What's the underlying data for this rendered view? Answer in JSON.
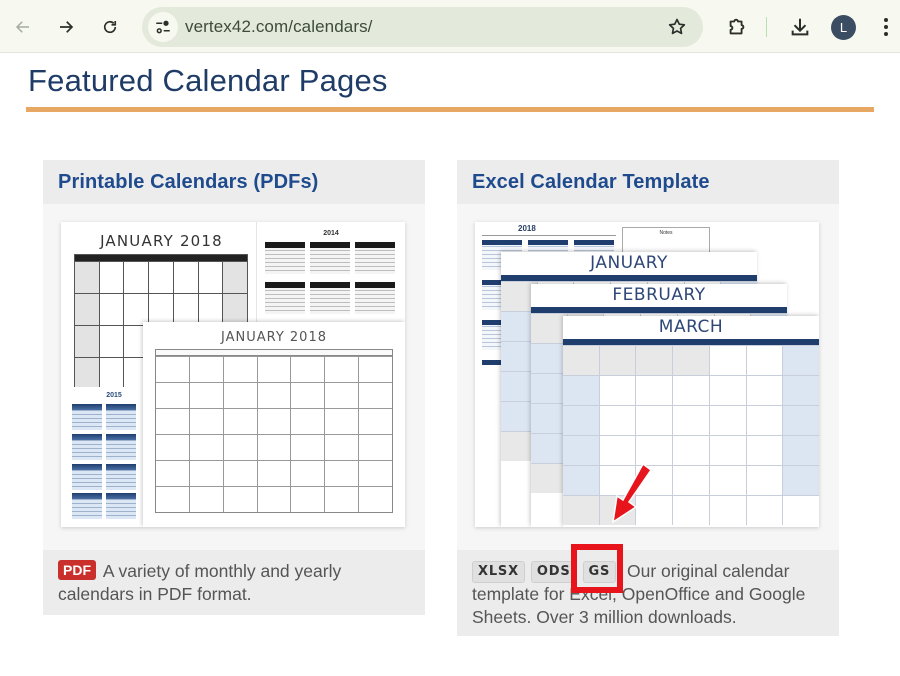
{
  "browser": {
    "url": "vertex42.com/calendars/",
    "profile_initial": "L",
    "icons": {
      "back": "arrow-left-icon",
      "forward": "arrow-right-icon",
      "reload": "reload-icon",
      "site_info": "tune-icon",
      "bookmark": "star-icon",
      "extensions": "puzzle-icon",
      "downloads": "download-icon",
      "menu": "kebab-menu-icon"
    }
  },
  "page": {
    "title": "Featured Calendar Pages",
    "accent_color": "#e6a862",
    "title_color": "#1f3c66",
    "link_color": "#1f4b8e"
  },
  "cards": [
    {
      "title": "Printable Calendars (PDFs)",
      "badges": [
        "PDF"
      ],
      "description": "A variety of monthly and yearly calendars in PDF format.",
      "image": {
        "pieces": {
          "monthly_title": "JANUARY 2018",
          "yearly_title": "2014",
          "blue_yearly_title": "2015",
          "landscape_title": "JANUARY 2018"
        }
      }
    },
    {
      "title": "Excel Calendar Template",
      "badges": [
        "XLSX",
        "ODS",
        "GS"
      ],
      "description": "Our original calendar template for Excel, OpenOffice and Google Sheets. Over 3 million downloads.",
      "image": {
        "pieces": {
          "yearly_title": "2018",
          "notes_title": "Notes",
          "sheet_1": "JANUARY",
          "sheet_2": "FEBRUARY",
          "sheet_3": "MARCH"
        }
      }
    }
  ],
  "annotation": {
    "highlighted_badge": "GS",
    "color": "#e8141c"
  }
}
